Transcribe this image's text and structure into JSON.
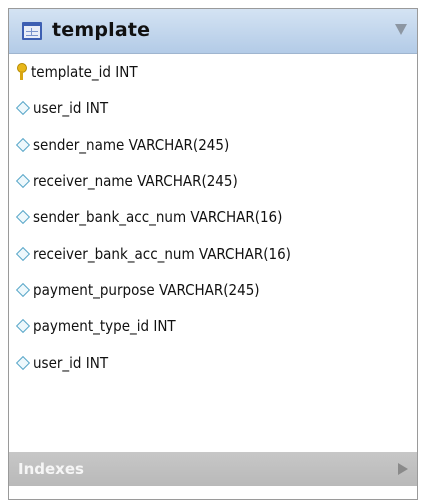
{
  "table": {
    "name": "template",
    "columns": [
      {
        "text": "template_id INT",
        "icon": "primary-key-icon"
      },
      {
        "text": "user_id INT",
        "icon": "column-diamond-icon"
      },
      {
        "text": "sender_name VARCHAR(245)",
        "icon": "column-diamond-icon"
      },
      {
        "text": "receiver_name VARCHAR(245)",
        "icon": "column-diamond-icon"
      },
      {
        "text": "sender_bank_acc_num VARCHAR(16)",
        "icon": "column-diamond-icon"
      },
      {
        "text": "receiver_bank_acc_num VARCHAR(16)",
        "icon": "column-diamond-icon"
      },
      {
        "text": "payment_purpose VARCHAR(245)",
        "icon": "column-diamond-icon"
      },
      {
        "text": "payment_type_id INT",
        "icon": "column-diamond-icon"
      },
      {
        "text": "user_id INT",
        "icon": "column-diamond-icon"
      }
    ],
    "indexes_label": "Indexes"
  },
  "colors": {
    "header_top": "#d4e3f3",
    "header_bottom": "#b3cbe7",
    "indexes_bar": "#c0c0c0",
    "key_yellow": "#e8b71a",
    "diamond_blue": "#58a6c8"
  }
}
